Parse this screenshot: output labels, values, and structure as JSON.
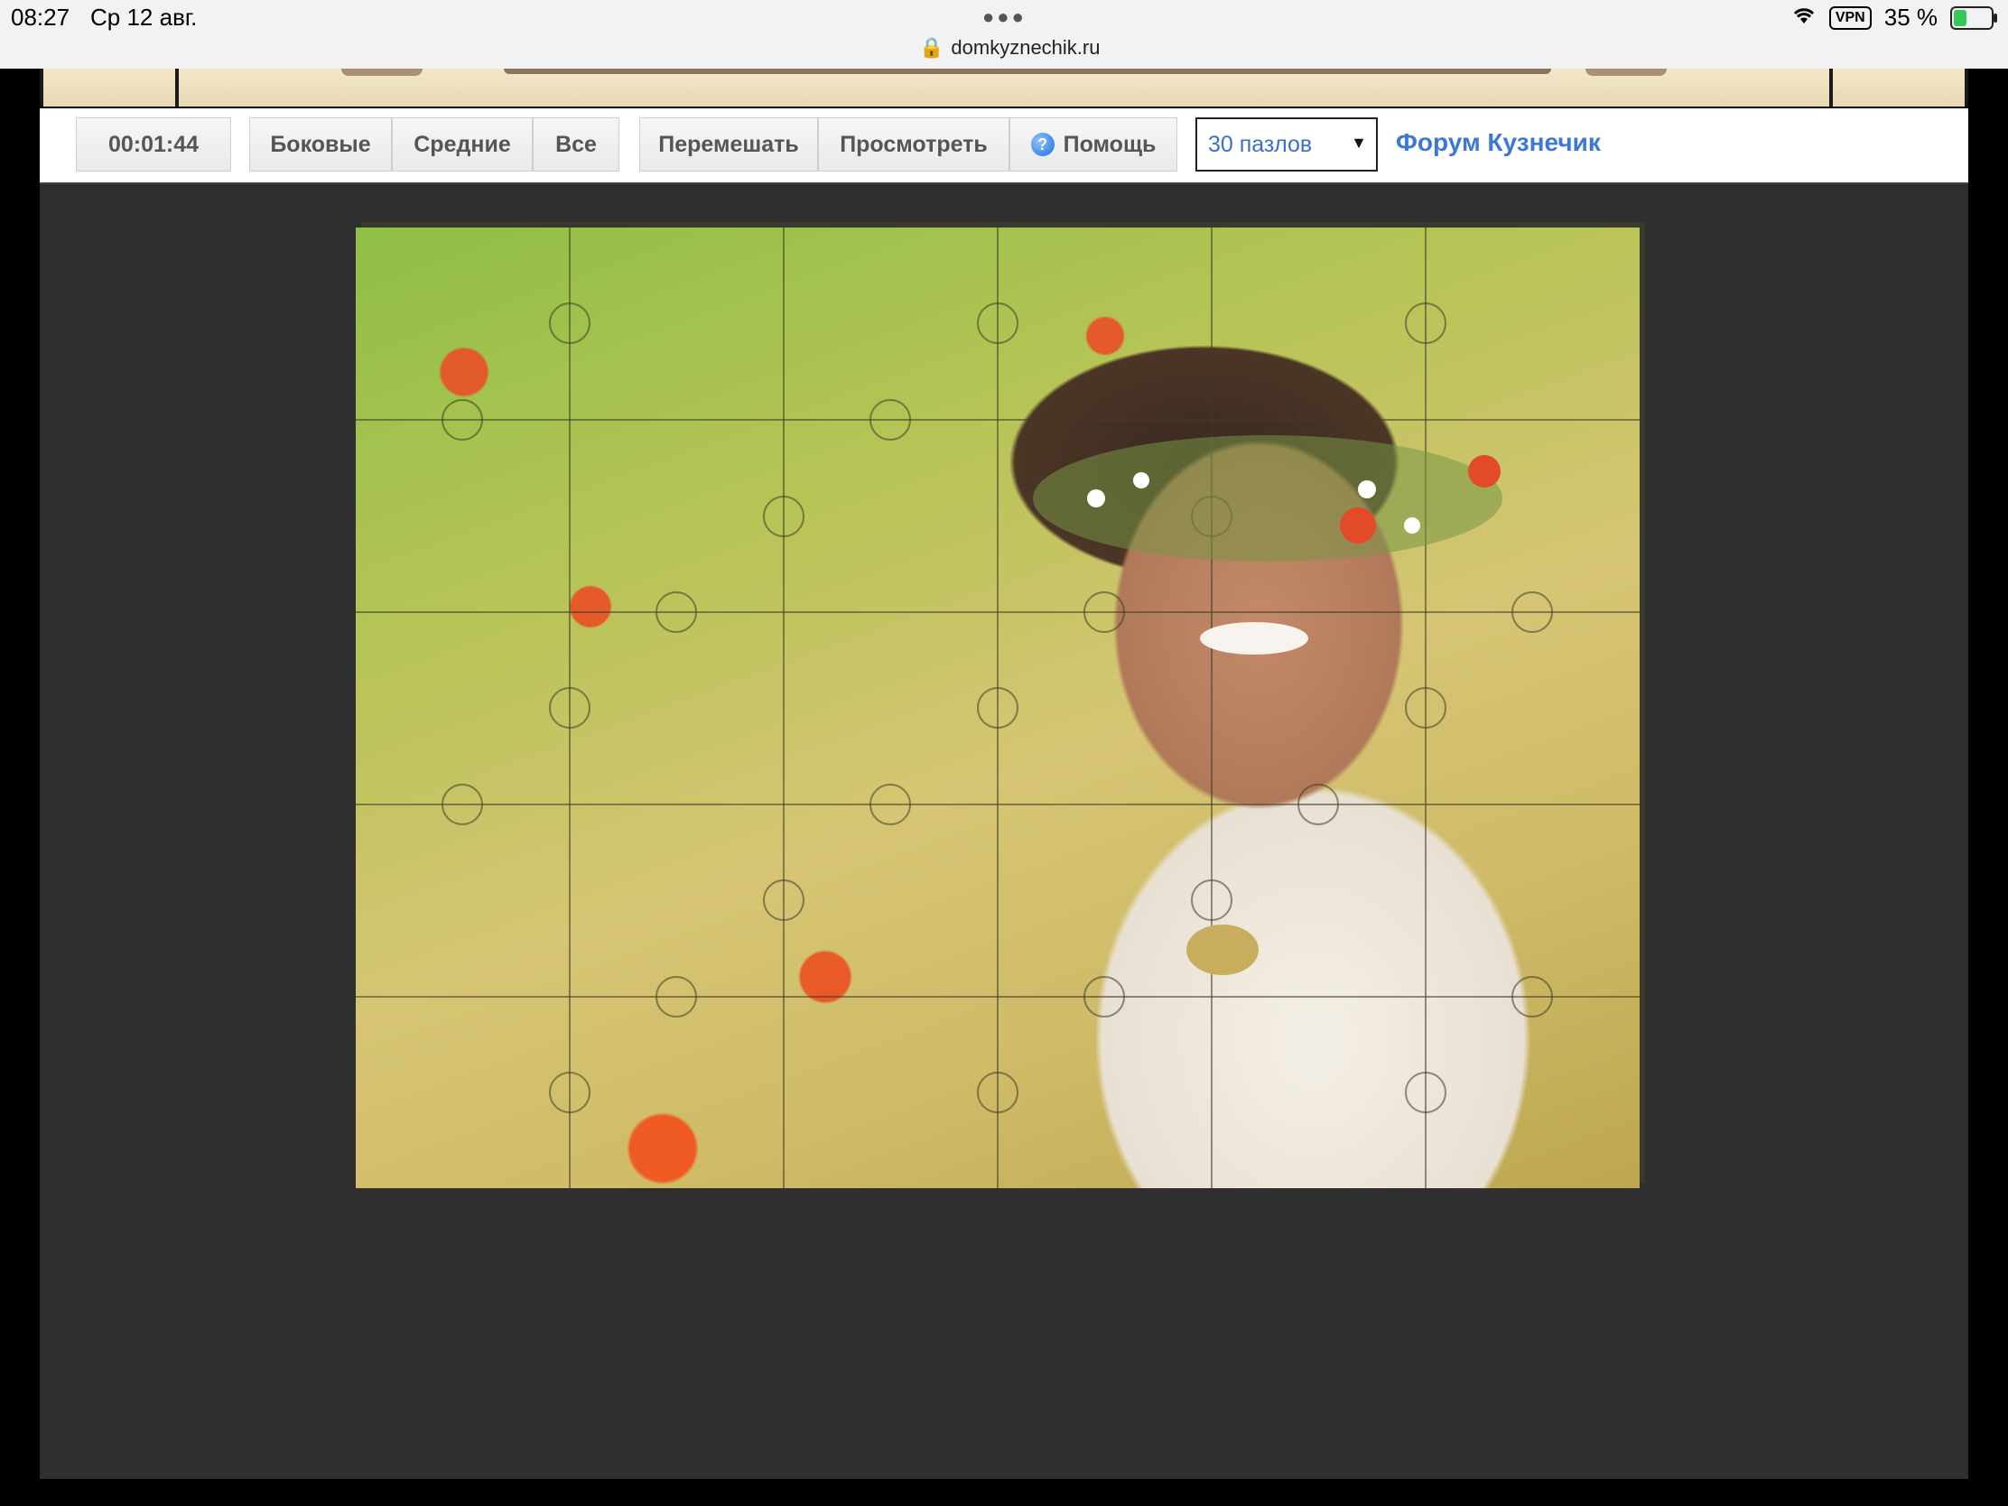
{
  "status_bar": {
    "time": "08:27",
    "date": "Ср 12 авг.",
    "url": "domkyznechik.ru",
    "vpn": "VPN",
    "battery": "35 %"
  },
  "toolbar": {
    "timer": "00:01:44",
    "filter_buttons": [
      "Боковые",
      "Средние",
      "Все"
    ],
    "shuffle_label": "Перемешать",
    "preview_label": "Просмотреть",
    "help_label": "Помощь",
    "pieces_select": "30 пазлов",
    "forum_link": "Форум Кузнечик"
  },
  "puzzle": {
    "pieces": 30,
    "columns": 6,
    "rows": 5,
    "subject": "woman-with-flower-wreath-in-meadow"
  },
  "colors": {
    "board_bg": "#2f2f2f",
    "link": "#3c78d8",
    "select_text": "#3b6fc9"
  }
}
